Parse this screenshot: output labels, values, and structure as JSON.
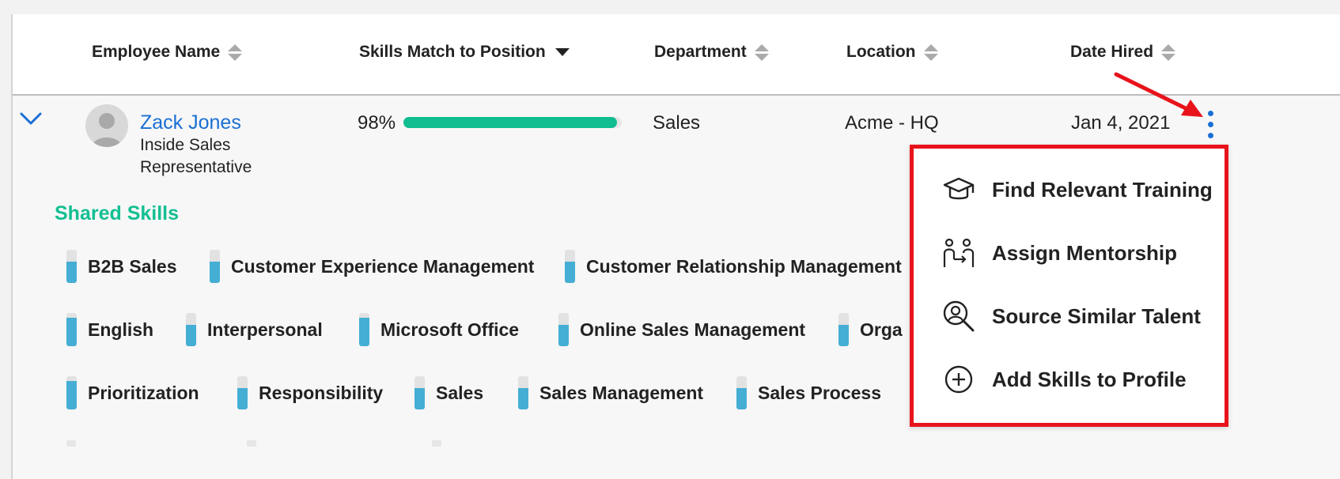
{
  "columns": {
    "employee_name": "Employee Name",
    "skills_match": "Skills Match to Position",
    "department": "Department",
    "location": "Location",
    "date_hired": "Date Hired"
  },
  "employee": {
    "name": "Zack Jones",
    "title_line1": "Inside Sales",
    "title_line2": "Representative",
    "match_percent_text": "98%",
    "match_percent": 98,
    "department": "Sales",
    "location": "Acme - HQ",
    "date_hired": "Jan 4, 2021"
  },
  "shared_skills": {
    "title": "Shared Skills",
    "items": [
      {
        "label": "B2B Sales",
        "level": 0.65
      },
      {
        "label": "Customer Experience Management",
        "level": 0.65
      },
      {
        "label": "Customer Relationship Management",
        "level": 0.65
      },
      {
        "label": "English",
        "level": 0.85
      },
      {
        "label": "Interpersonal",
        "level": 0.65
      },
      {
        "label": "Microsoft Office",
        "level": 0.85
      },
      {
        "label": "Online Sales Management",
        "level": 0.65
      },
      {
        "label": "Orga",
        "level": 0.65
      },
      {
        "label": "Prioritization",
        "level": 0.85
      },
      {
        "label": "Responsibility",
        "level": 0.65
      },
      {
        "label": "Sales",
        "level": 0.65
      },
      {
        "label": "Sales Management",
        "level": 0.65
      },
      {
        "label": "Sales Process",
        "level": 0.65
      }
    ]
  },
  "menu": {
    "items": [
      {
        "label": "Find Relevant Training",
        "icon": "graduation-cap-icon"
      },
      {
        "label": "Assign Mentorship",
        "icon": "mentorship-icon"
      },
      {
        "label": "Source Similar Talent",
        "icon": "search-person-icon"
      },
      {
        "label": "Add Skills to Profile",
        "icon": "plus-circle-icon"
      }
    ]
  },
  "colors": {
    "accent_blue": "#1a6fd4",
    "match_green": "#0fbd91",
    "skill_blue": "#45aed4",
    "highlight_red": "#e8131b"
  }
}
